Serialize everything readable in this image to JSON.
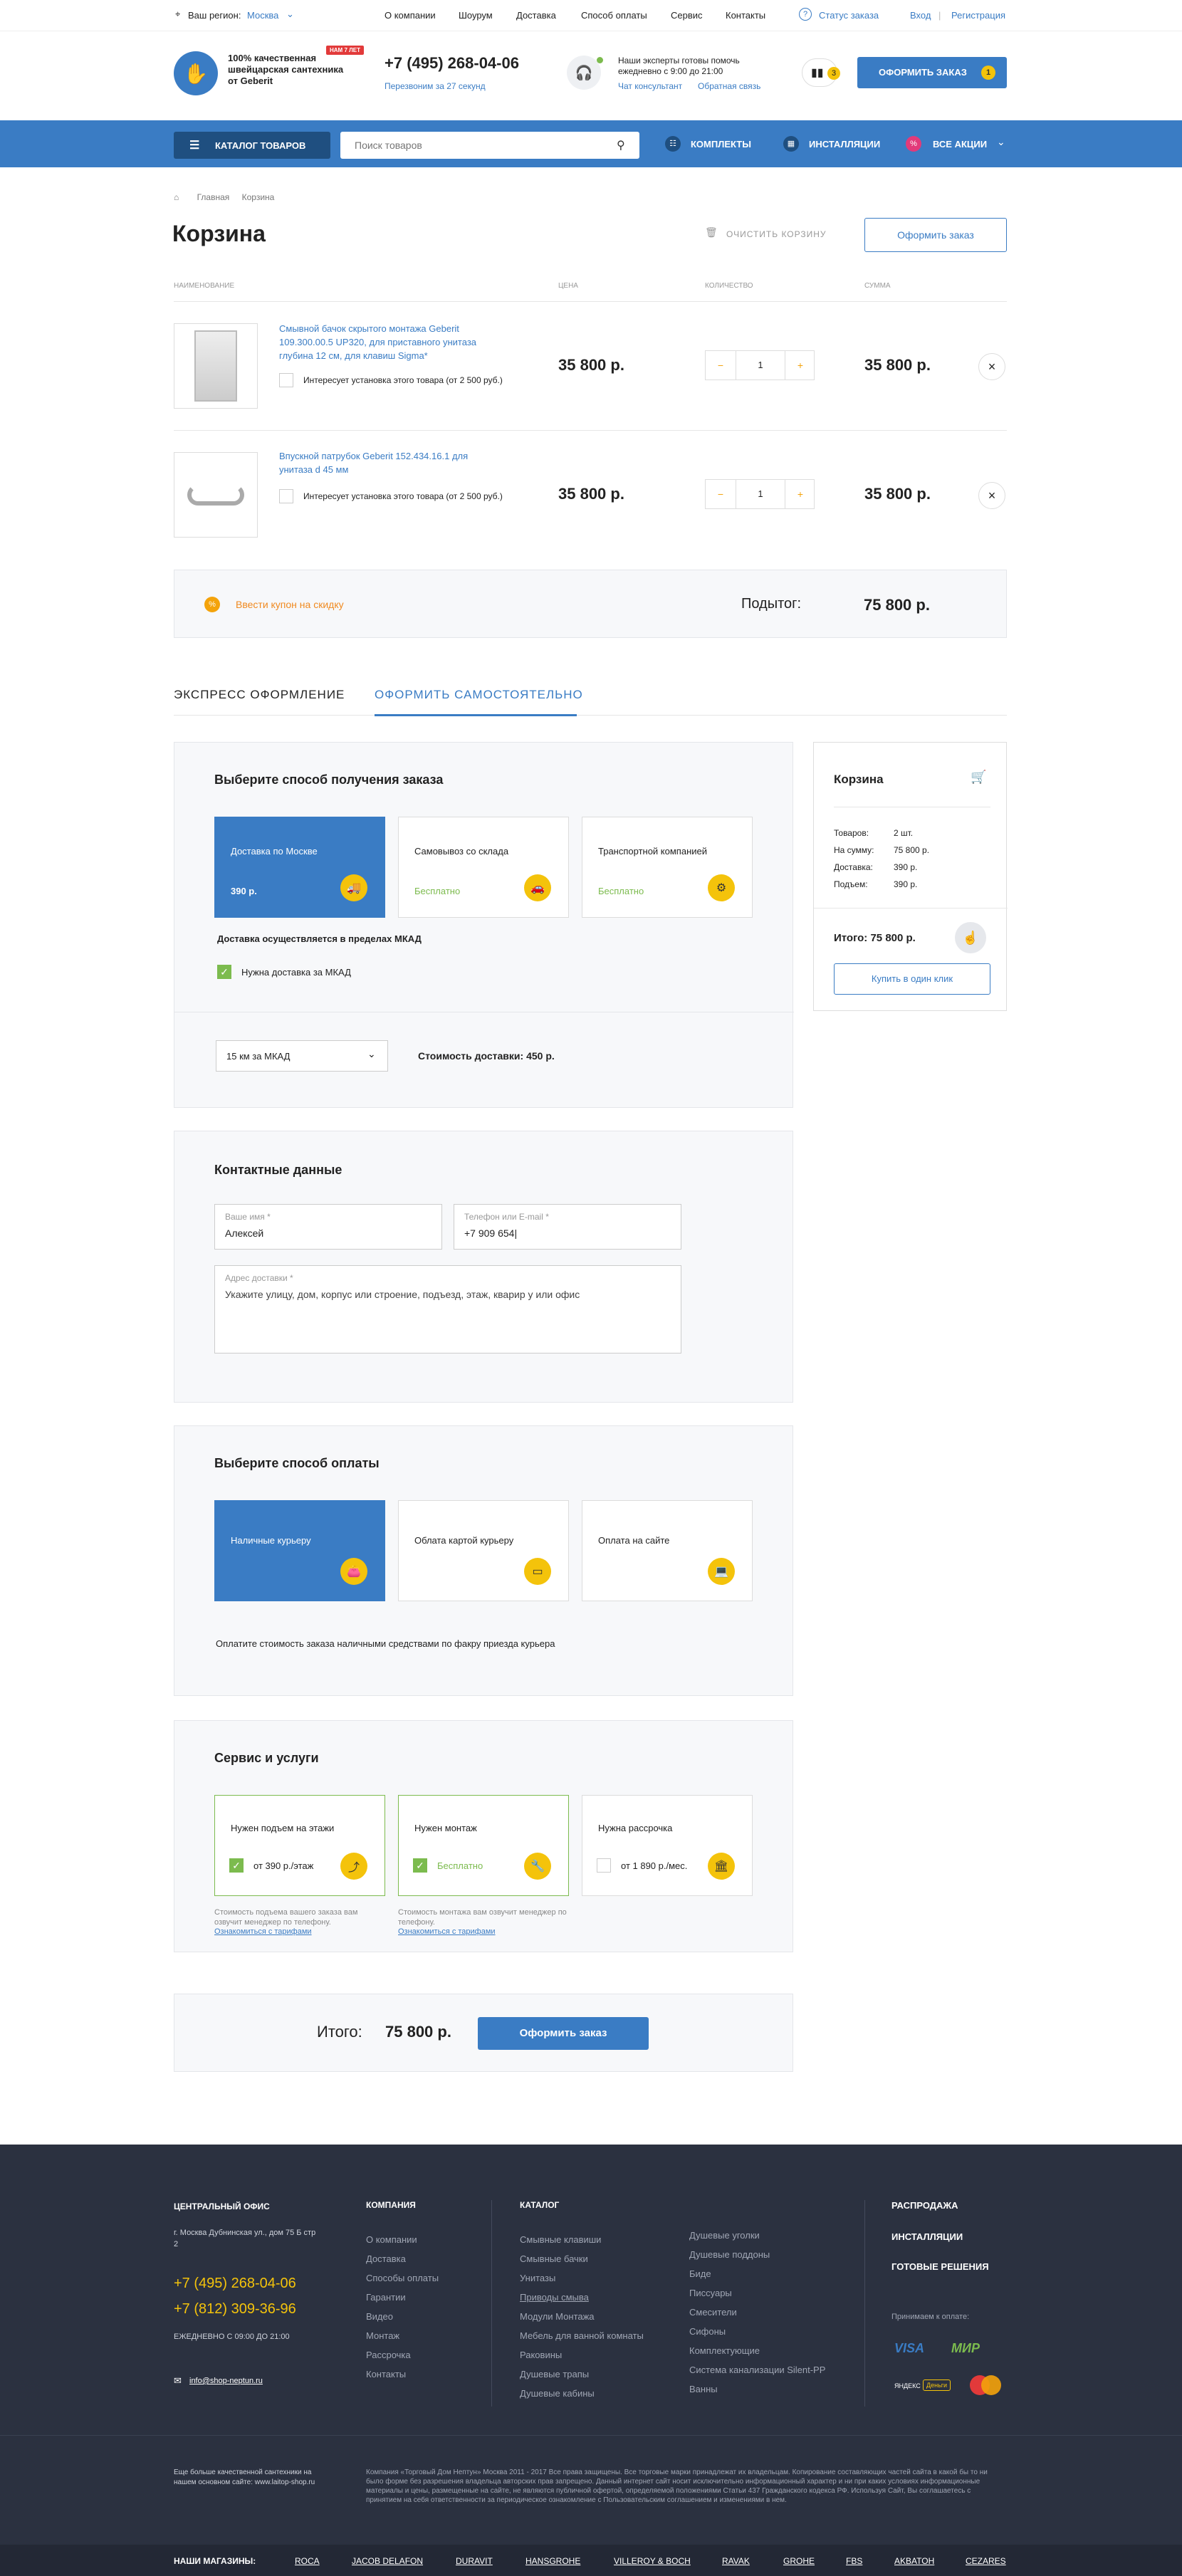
{
  "topbar": {
    "region_label": "Ваш регион:",
    "region_value": "Москва",
    "menu": [
      "О компании",
      "Шоурум",
      "Доставка",
      "Способ оплаты",
      "Сервис",
      "Контакты"
    ],
    "status": "Статус заказа",
    "login": "Вход",
    "register": "Регистрация",
    "sep": "|"
  },
  "header": {
    "tagline": "100% качественная швейцарская сантехника от Geberit",
    "badge": "НАМ 7 ЛЕТ",
    "phone": "+7 (495) 268-04-06",
    "callback": "Перезвоним за 27 секунд",
    "experts": "Наши эксперты готовы помочь ежедневно с 9:00 до 21:00",
    "chat": "Чат консультант",
    "feedback": "Обратная связь",
    "compare_count": "3",
    "order_btn": "ОФОРМИТЬ ЗАКАЗ",
    "order_count": "1"
  },
  "nav": {
    "catalog": "КАТАЛОГ ТОВАРОВ",
    "search_placeholder": "Поиск товаров",
    "kits": "КОМПЛЕКТЫ",
    "installations": "ИНСТАЛЛЯЦИИ",
    "sales": "ВСЕ АКЦИИ"
  },
  "breadcrumb": {
    "home": "Главная",
    "current": "Корзина"
  },
  "page": {
    "title": "Корзина",
    "clear": "ОЧИСТИТЬ КОРЗИНУ",
    "checkout": "Оформить заказ"
  },
  "table": {
    "headers": [
      "НАИМЕНОВАНИЕ",
      "ЦЕНА",
      "КОЛИЧЕСТВО",
      "СУММА"
    ],
    "rows": [
      {
        "name": "Смывной бачок скрытого монтажа Geberit 109.300.00.5 UP320, для приставного унитаза глубина 12 см, для клавиш Sigma*",
        "install": "Интересует установка этого товара (от 2 500 руб.)",
        "price": "35 800 р.",
        "qty": "1",
        "sum": "35 800 р."
      },
      {
        "name": "Впускной патрубок Geberit 152.434.16.1 для унитаза d 45 мм",
        "install": "Интересует установка этого товара (от 2 500 руб.)",
        "price": "35 800 р.",
        "qty": "1",
        "sum": "35 800 р."
      }
    ]
  },
  "coupon": {
    "label": "Ввести купон на скидку",
    "subtotal_label": "Подытог:",
    "subtotal": "75 800 р."
  },
  "tabs": {
    "express": "ЭКСПРЕСС ОФОРМЛЕНИЕ",
    "self": "ОФОРМИТЬ САМОСТОЯТЕЛЬНО"
  },
  "delivery": {
    "title": "Выберите способ получения заказа",
    "options": [
      {
        "label": "Доставка по Москве",
        "price": "390 р."
      },
      {
        "label": "Самовывоз со склада",
        "price": "Бесплатно"
      },
      {
        "label": "Транспортной компанией",
        "price": "Бесплатно"
      }
    ],
    "note": "Доставка осуществляется в пределах МКАД",
    "mkad": "Нужна доставка за МКАД",
    "distance": "15 км за МКАД",
    "cost": "Стоимость доставки: 450 р."
  },
  "contacts": {
    "title": "Контактные данные",
    "name_label": "Ваше имя *",
    "name_value": "Алексей",
    "phone_label": "Телефон или E-mail *",
    "phone_value": "+7 909 654|",
    "address_label": "Адрес доставки *",
    "address_placeholder": "Укажите улицу, дом, корпус или строение, подъезд, этаж, кварир у или офис"
  },
  "payment": {
    "title": "Выберите способ оплаты",
    "options": [
      "Наличные курьеру",
      "Облата картой курьеру",
      "Оплата на сайте"
    ],
    "note": "Оплатите стоимость заказа наличными средствами по факру приезда курьера"
  },
  "services": {
    "title": "Сервис и услуги",
    "options": [
      {
        "label": "Нужен подъем на этажи",
        "price": "от 390 р./этаж"
      },
      {
        "label": "Нужен монтаж",
        "price": "Бесплатно"
      },
      {
        "label": "Нужна рассрочка",
        "price": "от 1 890 р./мес."
      }
    ],
    "note1": "Стоимость подъема вашего заказа вам озвучит менеджер по телефону.",
    "note2": "Стоимость монтажа вам озвучит менеджер по телефону.",
    "tariffs": "Ознакомиться с тарифами"
  },
  "total": {
    "label": "Итого:",
    "value": "75 800 р.",
    "button": "Оформить заказ"
  },
  "summary": {
    "title": "Корзина",
    "rows": [
      {
        "k": "Товаров:",
        "v": "2 шт."
      },
      {
        "k": "На сумму:",
        "v": "75 800 р."
      },
      {
        "k": "Доставка:",
        "v": "390 р."
      },
      {
        "k": "Подъем:",
        "v": "390 р."
      }
    ],
    "total": "Итого: 75 800 р.",
    "oneclick": "Купить в один клик"
  },
  "footer": {
    "office_title": "ЦЕНТРАЛЬНЫЙ ОФИС",
    "address": "г. Москва Дубнинская ул., дом 75 Б стр 2",
    "phone1": "+7 (495) 268-04-06",
    "phone2": "+7 (812) 309-36-96",
    "hours": "ЕЖЕДНЕВНО С 09:00 ДО 21:00",
    "email": "info@shop-neptun.ru",
    "company_title": "КОМПАНИЯ",
    "company": [
      "О компании",
      "Доставка",
      "Способы оплаты",
      "Гарантии",
      "Видео",
      "Монтаж",
      "Рассрочка",
      "Контакты"
    ],
    "catalog_title": "КАТАЛОГ",
    "catalog1": [
      "Смывные клавиши",
      "Смывные бачки",
      "Унитазы",
      "Приводы смыва",
      "Модули Монтажа",
      "Мебель для ванной комнаты",
      "Раковины",
      "Душевые трапы",
      "Душевые кабины"
    ],
    "catalog2": [
      "Душевые уголки",
      "Душевые поддоны",
      "Биде",
      "Писсуары",
      "Смесители",
      "Сифоны",
      "Комплектующие",
      "Система канализации Silent-PP",
      "Ванны"
    ],
    "right": [
      "РАСПРОДАЖА",
      "ИНСТАЛЛЯЦИИ",
      "ГОТОВЫЕ РЕШЕНИЯ"
    ],
    "pay_title": "Принимаем к оплате:",
    "pay": [
      "VISA",
      "МИР",
      "ЯНДЕКС",
      "Деньги"
    ],
    "more": "Еще больше качественной сантехники на нашем основном сайте: www.laitop-shop.ru",
    "legal": "Компания «Торговый Дом Нептун» Москва 2011 - 2017 Все права защищены. Все торговые марки принадлежат их владельцам. Копирование составляющих частей сайта в какой бы то ни было форме без разрешения владельца авторских прав запрещено. Данный интернет сайт носит исключительно информационный характер и ни при каких условиях информационные материалы и цены, размещенные на сайте, не являются публичной офертой, определяемой положениями Статьи 437 Гражданского кодекса РФ. Используя Сайт, Вы соглашаетесь с принятием на себя ответственности за периодическое ознакомление с Пользовательским соглашением и изменениями в нем.",
    "stores_title": "НАШИ МАГАЗИНЫ:",
    "stores": [
      "ROCA",
      "JACOB DELAFON",
      "DURAVIT",
      "HANSGROHE",
      "VILLEROY & BOCH",
      "RAVAK",
      "GROHE",
      "FBS",
      "AKBATOH",
      "CEZARES"
    ]
  }
}
